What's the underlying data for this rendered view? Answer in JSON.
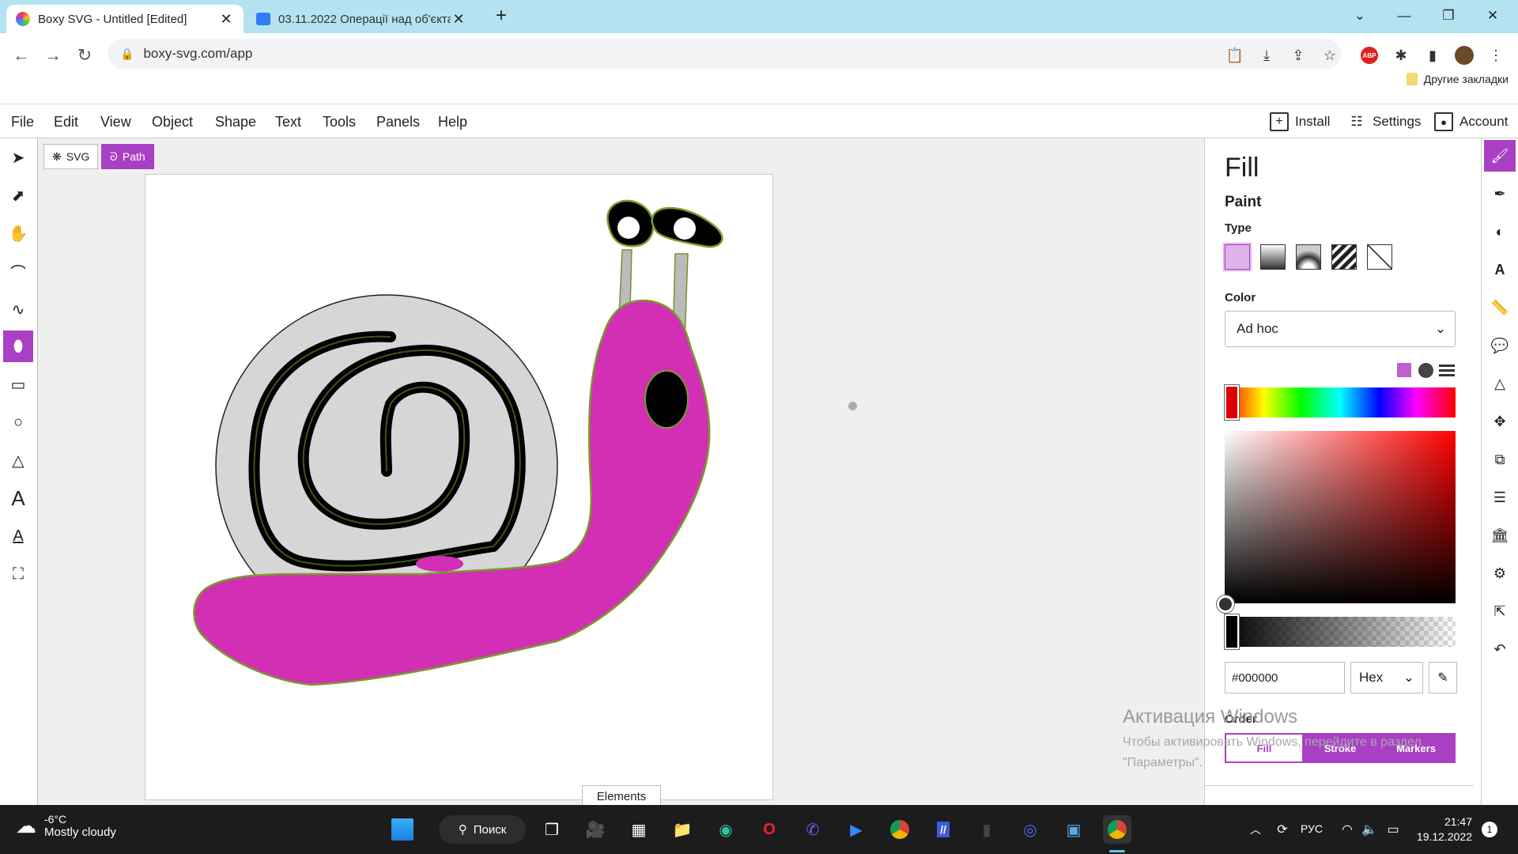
{
  "browser": {
    "tabs": [
      {
        "title": "Boxy SVG - Untitled [Edited]",
        "active": true
      },
      {
        "title": "03.11.2022 Операції над об'єкта",
        "active": false
      }
    ],
    "new_tab": "+",
    "url": "boxy-svg.com/app",
    "bookmark_folder": "Другие закладки",
    "ext_abp": "ABP"
  },
  "app": {
    "menu": [
      "File",
      "Edit",
      "View",
      "Object",
      "Shape",
      "Text",
      "Tools",
      "Panels",
      "Help"
    ],
    "right_menu": {
      "install": "Install",
      "settings": "Settings",
      "account": "Account"
    },
    "breadcrumb": {
      "svg": "SVG",
      "path": "Path"
    },
    "elements_tab": "Elements",
    "accent": "#a940c4"
  },
  "fill_panel": {
    "title": "Fill",
    "section": "Paint",
    "type_label": "Type",
    "color_label": "Color",
    "color_mode": "Ad hoc",
    "hex_value": "#000000",
    "format": "Hex",
    "order_label": "Order",
    "order_tabs": [
      "Fill",
      "Stroke",
      "Markers"
    ]
  },
  "watermark": {
    "line1": "Активация Windows",
    "line2": "Чтобы активировать Windows, перейдите в раздел",
    "line3": "\"Параметры\"."
  },
  "taskbar": {
    "weather_temp": "-6°C",
    "weather_desc": "Mostly cloudy",
    "search": "Поиск",
    "lang": "РУС",
    "time": "21:47",
    "date": "19.12.2022",
    "notif": "1"
  }
}
